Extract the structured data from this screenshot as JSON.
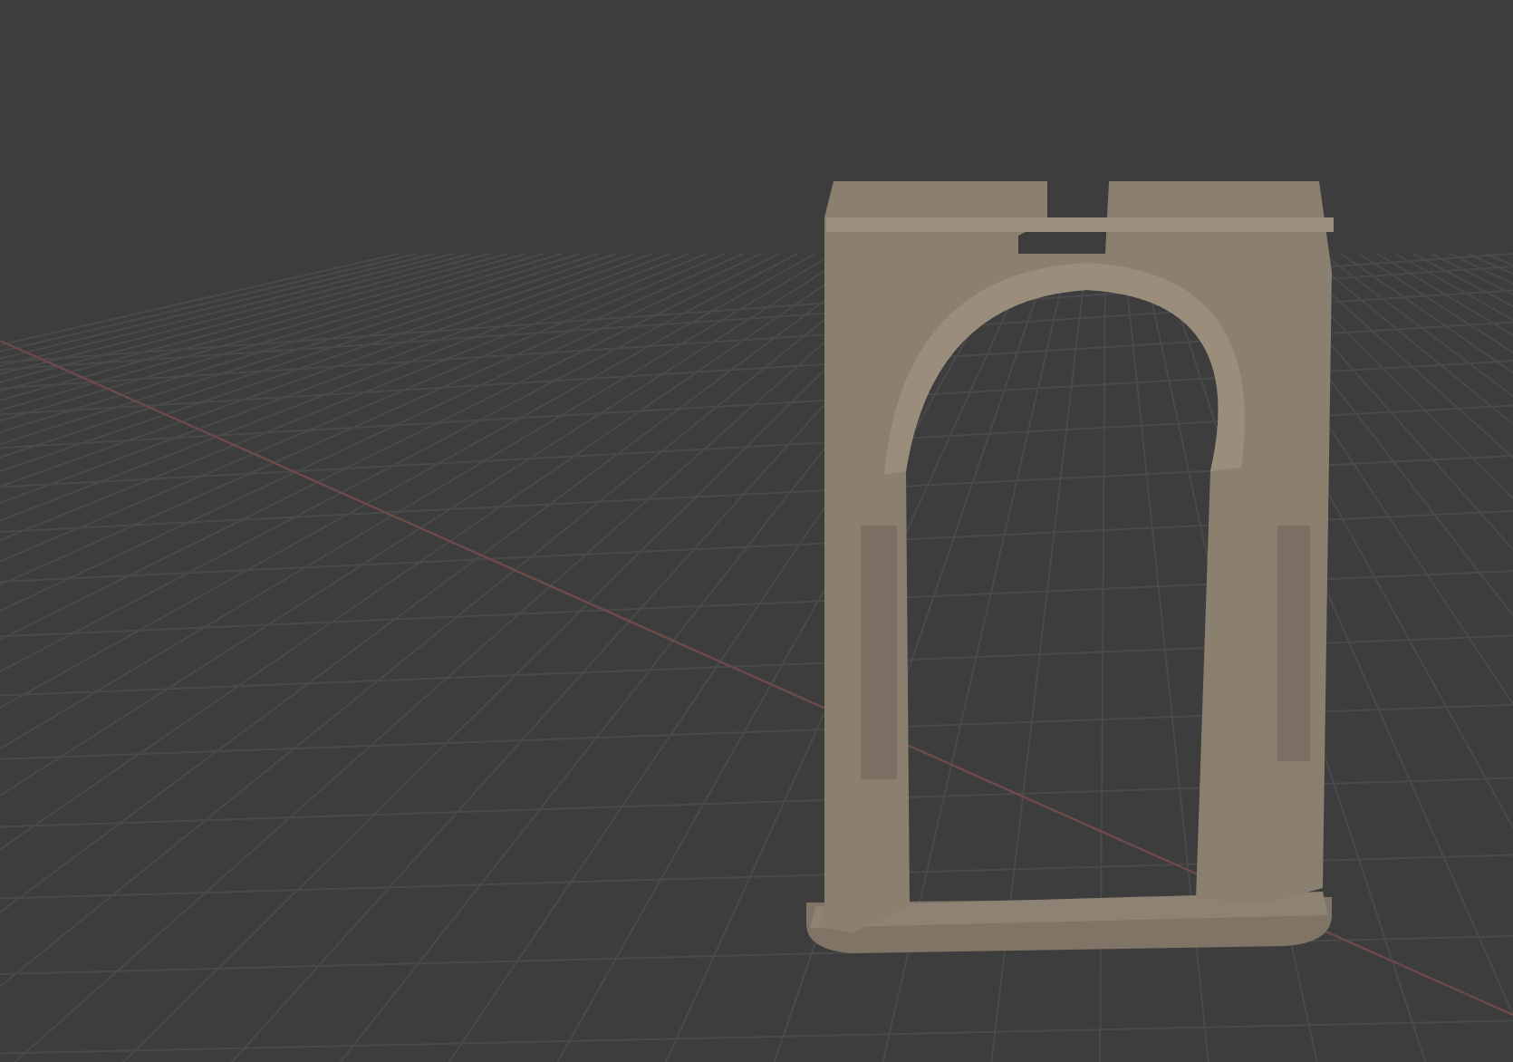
{
  "viewport": {
    "grid": true,
    "axis_line": true
  }
}
